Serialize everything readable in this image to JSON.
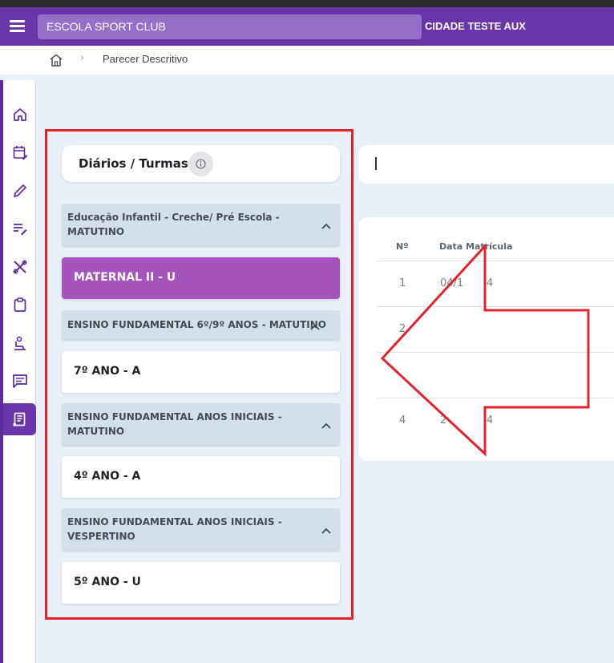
{
  "appbar": {
    "school": "ESCOLA SPORT CLUB",
    "city": "CIDADE TESTE AUX"
  },
  "breadcrumb": {
    "page": "Parecer Descritivo"
  },
  "sidebar": {
    "items": [
      "home-icon",
      "calendar-edit-icon",
      "pencil-icon",
      "notes-edit-icon",
      "tools-icon",
      "clipboard-icon",
      "student-desk-icon",
      "chat-icon",
      "report-icon"
    ],
    "active_index": 8
  },
  "panel": {
    "title": "Diários / Turmas",
    "groups": [
      {
        "label": "Educação Infantil - Creche/ Pré Escola - MATUTINO",
        "classes": [
          {
            "label": "MATERNAL II - U",
            "selected": true
          }
        ]
      },
      {
        "label": "ENSINO FUNDAMENTAL 6º/9º ANOS - MATUTINO",
        "classes": [
          {
            "label": "7º ANO - A"
          }
        ]
      },
      {
        "label": "ENSINO FUNDAMENTAL ANOS INICIAIS - MATUTINO",
        "classes": [
          {
            "label": "4º ANO - A"
          }
        ]
      },
      {
        "label": "ENSINO FUNDAMENTAL ANOS INICIAIS - VESPERTINO",
        "classes": [
          {
            "label": "5º ANO - U"
          }
        ]
      }
    ]
  },
  "table": {
    "headers": [
      "Nº",
      "Data Matrícula"
    ],
    "rows": [
      {
        "n": "1",
        "date": "04/1"
      },
      {
        "n": "2",
        "date": ""
      },
      {
        "n": "",
        "date": ""
      },
      {
        "n": "4",
        "date": "2"
      }
    ],
    "partial_tail": "4"
  },
  "colors": {
    "brand": "#6a35a9",
    "selected_class": "#a553bd",
    "highlight": "#e3222d"
  }
}
